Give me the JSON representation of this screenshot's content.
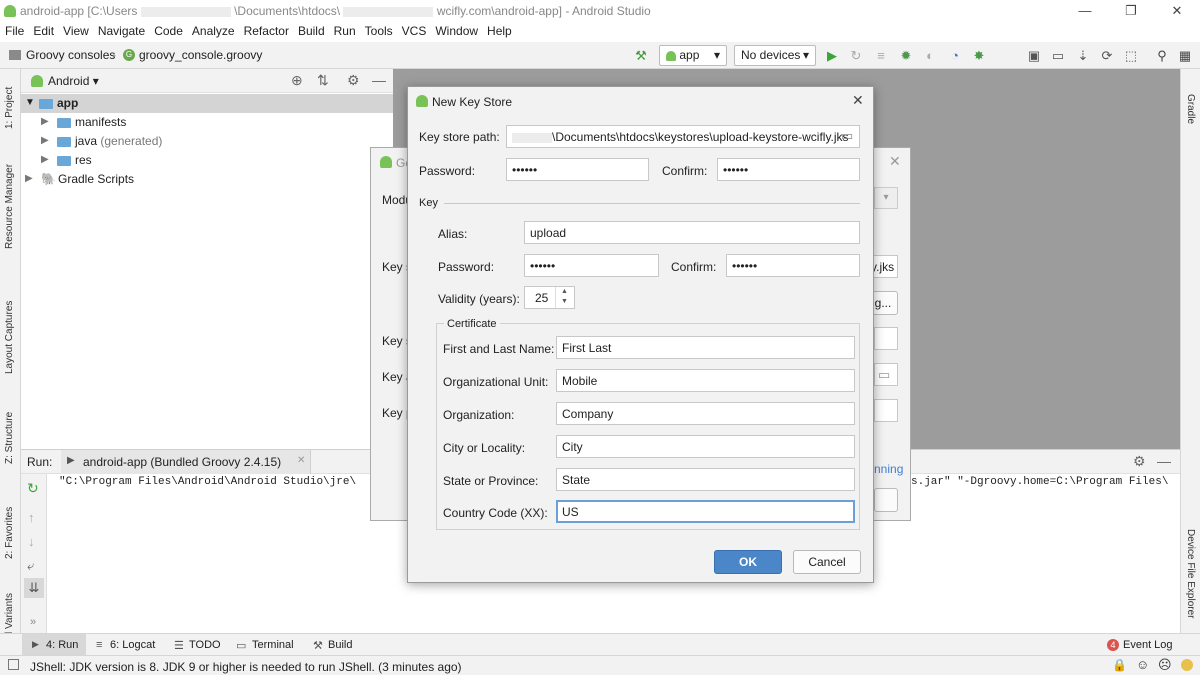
{
  "window": {
    "title_prefix": "android-app [C:\\Users",
    "title_mid": "\\Documents\\htdocs\\",
    "title_suffix": "wcifly.com\\android-app] - Android Studio",
    "minimize": "—",
    "maximize": "❐",
    "close": "✕"
  },
  "menu": [
    "File",
    "Edit",
    "View",
    "Navigate",
    "Code",
    "Analyze",
    "Refactor",
    "Build",
    "Run",
    "Tools",
    "VCS",
    "Window",
    "Help"
  ],
  "breadcrumb": [
    "Groovy consoles",
    "groovy_console.groovy"
  ],
  "toolbar": {
    "config": "app",
    "devices": "No devices"
  },
  "left_tabs": [
    "1: Project",
    "Resource Manager",
    "Layout Captures",
    "Z: Structure",
    "2: Favorites",
    "Build Variants"
  ],
  "right_tabs": [
    "Gradle",
    "Device File Explorer"
  ],
  "project": {
    "view": "Android",
    "tree": [
      {
        "label": "app",
        "level": 0
      },
      {
        "label": "manifests",
        "level": 1
      },
      {
        "label": "java",
        "suffix": " (generated)",
        "level": 1
      },
      {
        "label": "res",
        "level": 1
      },
      {
        "label": "Gradle Scripts",
        "level": 0
      }
    ]
  },
  "run": {
    "label": "Run:",
    "tab": "android-app (Bundled Groovy 2.4.15)",
    "cmd_left": "\"C:\\Program Files\\Android\\Android Studio\\jre\\",
    "cmd_right": "s.jar\" \"-Dgroovy.home=C:\\Program Files\\"
  },
  "bg_dialog": {
    "title": "Ge",
    "labels": [
      "Modu",
      "Key s",
      "Key s",
      "Key a",
      "Key p"
    ],
    "file_suffix": "y.jks",
    "button_partial": "g...",
    "link_partial": "nning"
  },
  "dialog": {
    "title": "New Key Store",
    "keystore_path_label": "Key store path:",
    "keystore_path": "\\Documents\\htdocs\\keystores\\upload-keystore-wcifly.jks",
    "password_label": "Password:",
    "password": "••••••",
    "confirm_label": "Confirm:",
    "confirm": "••••••",
    "key_section": "Key",
    "alias_label": "Alias:",
    "alias": "upload",
    "key_password_label": "Password:",
    "key_password": "••••••",
    "key_confirm_label": "Confirm:",
    "key_confirm": "••••••",
    "validity_label": "Validity (years):",
    "validity": "25",
    "certificate_section": "Certificate",
    "first_last_label": "First and Last Name:",
    "first_last": "First Last",
    "org_unit_label": "Organizational Unit:",
    "org_unit": "Mobile",
    "org_label": "Organization:",
    "org": "Company",
    "city_label": "City or Locality:",
    "city": "City",
    "state_label": "State or Province:",
    "state": "State",
    "country_label": "Country Code (XX):",
    "country": "US",
    "ok": "OK",
    "cancel": "Cancel"
  },
  "bottom_tabs": [
    "4: Run",
    "6: Logcat",
    "TODO",
    "Terminal",
    "Build"
  ],
  "event_log": {
    "count": "4",
    "label": "Event Log"
  },
  "status": "JShell: JDK version is 8. JDK 9 or higher is needed to run JShell. (3 minutes ago)",
  "colors": {
    "accent": "#4a86c8",
    "ok_button": "#3d7fcf",
    "android_green": "#78c257"
  }
}
